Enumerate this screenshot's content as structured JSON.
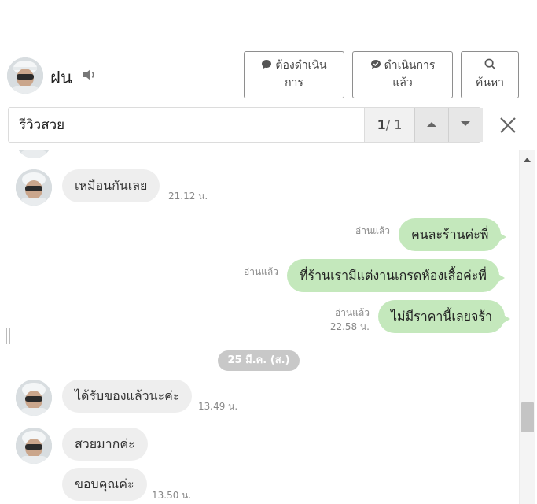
{
  "header": {
    "contact_name": "ฝน",
    "btn_pending_line1": "ต้องดำเนิน",
    "btn_pending_line2": "การ",
    "btn_done_line1": "ดำเนินการ",
    "btn_done_line2": "แล้ว",
    "btn_search_label": "ค้นหา"
  },
  "search": {
    "query": "รีวิวสวย",
    "count_current": "1",
    "count_total": "/ 1"
  },
  "messages": [
    {
      "side": "in",
      "text": "เหมือนกันเลย",
      "time": "21.12 น."
    },
    {
      "side": "out",
      "text": "คนละร้านค่ะพี่",
      "read": "อ่านแล้ว"
    },
    {
      "side": "out",
      "text": "ที่ร้านเรามีแต่งานเกรดห้องเสื้อค่ะพี่",
      "read": "อ่านแล้ว"
    },
    {
      "side": "out",
      "text": "ไม่มีราคานี้เลยจร้า",
      "read": "อ่านแล้ว",
      "time": "22.58 น."
    },
    {
      "side": "in",
      "text": "ได้รับของแล้วนะค่ะ",
      "time": "13.49 น."
    },
    {
      "side": "in",
      "text": "สวยมากค่ะ"
    },
    {
      "side": "in",
      "text": "ขอบคุณค่ะ",
      "time": "13.50 น."
    }
  ],
  "date_separator": "25 มี.ค. (ส.)",
  "colors": {
    "outgoing_bubble": "#c4e8bc",
    "incoming_bubble": "#eeeeee",
    "date_pill": "#c8c8c8",
    "pending_icon": "#555555",
    "done_icon": "#555555"
  },
  "icons": {
    "speaker": "speaker-icon",
    "pending": "speech-bubble-icon",
    "done": "check-bubble-icon",
    "search": "magnifier-icon",
    "up": "caret-up-icon",
    "down": "caret-down-icon",
    "close": "close-icon"
  }
}
